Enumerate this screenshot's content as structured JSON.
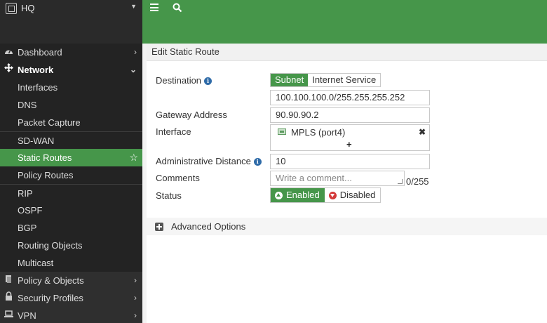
{
  "header": {
    "device_name": "HQ",
    "brand_color": "#46964a"
  },
  "sidebar": {
    "items": [
      {
        "label": "Dashboard",
        "icon": "dashboard-icon"
      },
      {
        "label": "Network",
        "icon": "network-icon"
      },
      {
        "label": "Interfaces"
      },
      {
        "label": "DNS"
      },
      {
        "label": "Packet Capture"
      },
      {
        "label": "SD-WAN"
      },
      {
        "label": "Static Routes"
      },
      {
        "label": "Policy Routes"
      },
      {
        "label": "RIP"
      },
      {
        "label": "OSPF"
      },
      {
        "label": "BGP"
      },
      {
        "label": "Routing Objects"
      },
      {
        "label": "Multicast"
      },
      {
        "label": "Policy & Objects",
        "icon": "policy-icon"
      },
      {
        "label": "Security Profiles",
        "icon": "lock-icon"
      },
      {
        "label": "VPN",
        "icon": "laptop-icon"
      }
    ]
  },
  "page": {
    "title": "Edit Static Route"
  },
  "form": {
    "destination_label": "Destination",
    "destination_modes": [
      "Subnet",
      "Internet Service"
    ],
    "destination_value": "100.100.100.0/255.255.255.252",
    "gateway_label": "Gateway Address",
    "gateway_value": "90.90.90.2",
    "interface_label": "Interface",
    "interface_value": "MPLS (port4)",
    "interface_add": "+",
    "interface_remove": "✖",
    "distance_label": "Administrative Distance",
    "distance_value": "10",
    "comments_label": "Comments",
    "comments_placeholder": "Write a comment...",
    "comments_counter": "0/255",
    "status_label": "Status",
    "status_enabled": "Enabled",
    "status_disabled": "Disabled",
    "info_glyph": "i",
    "advanced_label": "Advanced Options"
  }
}
